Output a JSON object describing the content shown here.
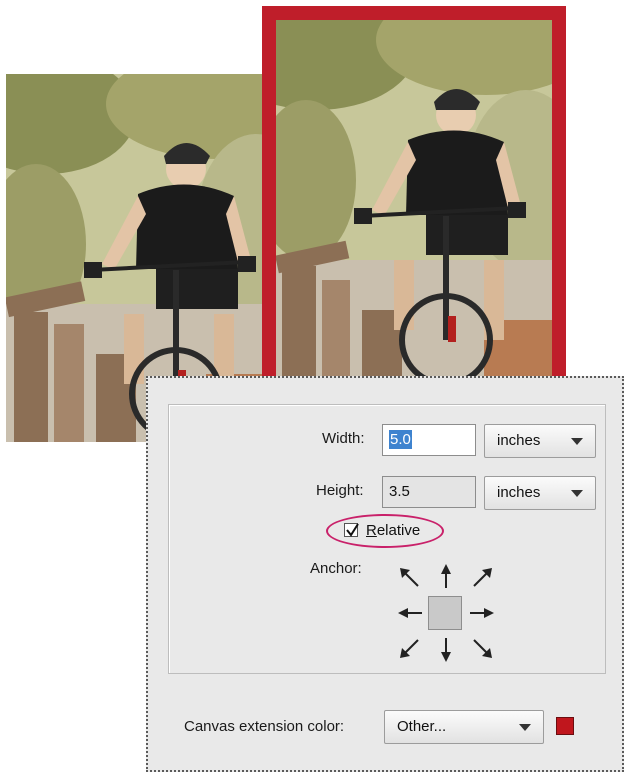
{
  "dialog": {
    "width": {
      "label": "Width:",
      "value": "5.0",
      "unit": "inches"
    },
    "height": {
      "label": "Height:",
      "value": "3.5",
      "unit": "inches"
    },
    "relative": {
      "label": "Relative",
      "checked": true
    },
    "anchor": {
      "label": "Anchor:"
    },
    "canvas_extension": {
      "label": "Canvas extension color:",
      "value": "Other...",
      "swatch_color": "#c0161d"
    }
  },
  "colors": {
    "frame_highlight": "#bf1e2a",
    "ellipse_highlight": "#c9216a",
    "selection": "#3e83cf"
  }
}
